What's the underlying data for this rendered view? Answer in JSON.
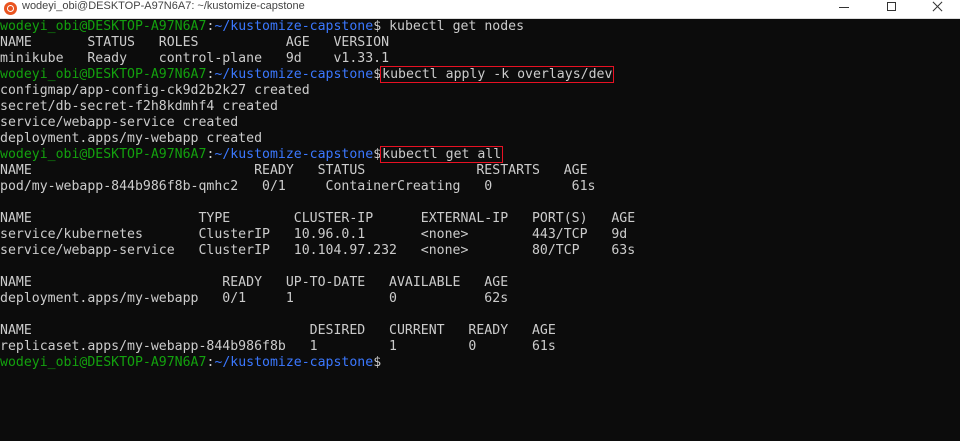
{
  "window": {
    "title": "wodeyi_obi@DESKTOP-A97N6A7: ~/kustomize-capstone",
    "icon": "ubuntu-icon",
    "controls": [
      "minimize-icon",
      "maximize-icon",
      "close-icon"
    ]
  },
  "prompt": {
    "user_host": "wodeyi_obi@DESKTOP-A97N6A7",
    "path": "~/kustomize-capstone",
    "user_color": "#13a10e",
    "path_color": "#3b78ff"
  },
  "highlight_color": "#e81123",
  "terminal": {
    "lines": [
      {
        "type": "prompt",
        "cmd": " kubectl get nodes"
      },
      {
        "type": "out",
        "text": "NAME       STATUS   ROLES           AGE   VERSION"
      },
      {
        "type": "out",
        "text": "minikube   Ready    control-plane   9d    v1.33.1"
      },
      {
        "type": "prompt",
        "cmd": "kubectl apply -k overlays/dev",
        "highlighted": true
      },
      {
        "type": "out",
        "text": "configmap/app-config-ck9d2b2k27 created"
      },
      {
        "type": "out",
        "text": "secret/db-secret-f2h8kdmhf4 created"
      },
      {
        "type": "out",
        "text": "service/webapp-service created"
      },
      {
        "type": "out",
        "text": "deployment.apps/my-webapp created"
      },
      {
        "type": "prompt",
        "cmd": "kubectl get all",
        "highlighted": true
      },
      {
        "type": "out",
        "text": "NAME                            READY   STATUS              RESTARTS   AGE"
      },
      {
        "type": "out",
        "text": "pod/my-webapp-844b986f8b-qmhc2   0/1     ContainerCreating   0          61s"
      },
      {
        "type": "out",
        "text": ""
      },
      {
        "type": "out",
        "text": "NAME                     TYPE        CLUSTER-IP      EXTERNAL-IP   PORT(S)   AGE"
      },
      {
        "type": "out",
        "text": "service/kubernetes       ClusterIP   10.96.0.1       <none>        443/TCP   9d"
      },
      {
        "type": "out",
        "text": "service/webapp-service   ClusterIP   10.104.97.232   <none>        80/TCP    63s"
      },
      {
        "type": "out",
        "text": ""
      },
      {
        "type": "out",
        "text": "NAME                        READY   UP-TO-DATE   AVAILABLE   AGE"
      },
      {
        "type": "out",
        "text": "deployment.apps/my-webapp   0/1     1            0           62s"
      },
      {
        "type": "out",
        "text": ""
      },
      {
        "type": "out",
        "text": "NAME                                   DESIRED   CURRENT   READY   AGE"
      },
      {
        "type": "out",
        "text": "replicaset.apps/my-webapp-844b986f8b   1         1         0       61s"
      },
      {
        "type": "prompt",
        "cmd": ""
      }
    ]
  }
}
